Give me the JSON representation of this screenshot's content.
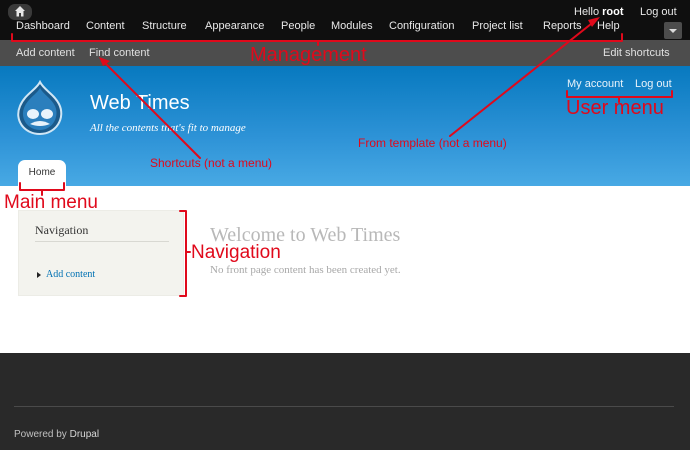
{
  "toolbar": {
    "menu": [
      "Dashboard",
      "Content",
      "Structure",
      "Appearance",
      "People",
      "Modules",
      "Configuration",
      "Project list",
      "Reports",
      "Help"
    ],
    "hello_prefix": "Hello",
    "username": "root",
    "logout": "Log out"
  },
  "shortcuts": {
    "add_content": "Add content",
    "find_content": "Find content",
    "edit_shortcuts": "Edit shortcuts"
  },
  "header": {
    "site_name": "Web Times",
    "slogan": "All the contents that's fit to manage",
    "user_menu": [
      "My account",
      "Log out"
    ],
    "main_menu": [
      "Home"
    ]
  },
  "sidebar": {
    "title": "Navigation",
    "items": [
      "Add content"
    ]
  },
  "main": {
    "title": "Welcome to Web Times",
    "message": "No front page content has been created yet."
  },
  "footer": {
    "powered_prefix": "Powered by",
    "powered_link": "Drupal"
  },
  "annotations": {
    "management": "Management",
    "user_menu": "User menu",
    "shortcuts": "Shortcuts (not a menu)",
    "from_template": "From template (not a menu)",
    "main_menu": "Main menu",
    "navigation": "Navigation"
  },
  "colors": {
    "annotation": "#e0091b",
    "link": "#0071b3",
    "header_top": "#0779bf",
    "header_bottom": "#48a9e4"
  }
}
